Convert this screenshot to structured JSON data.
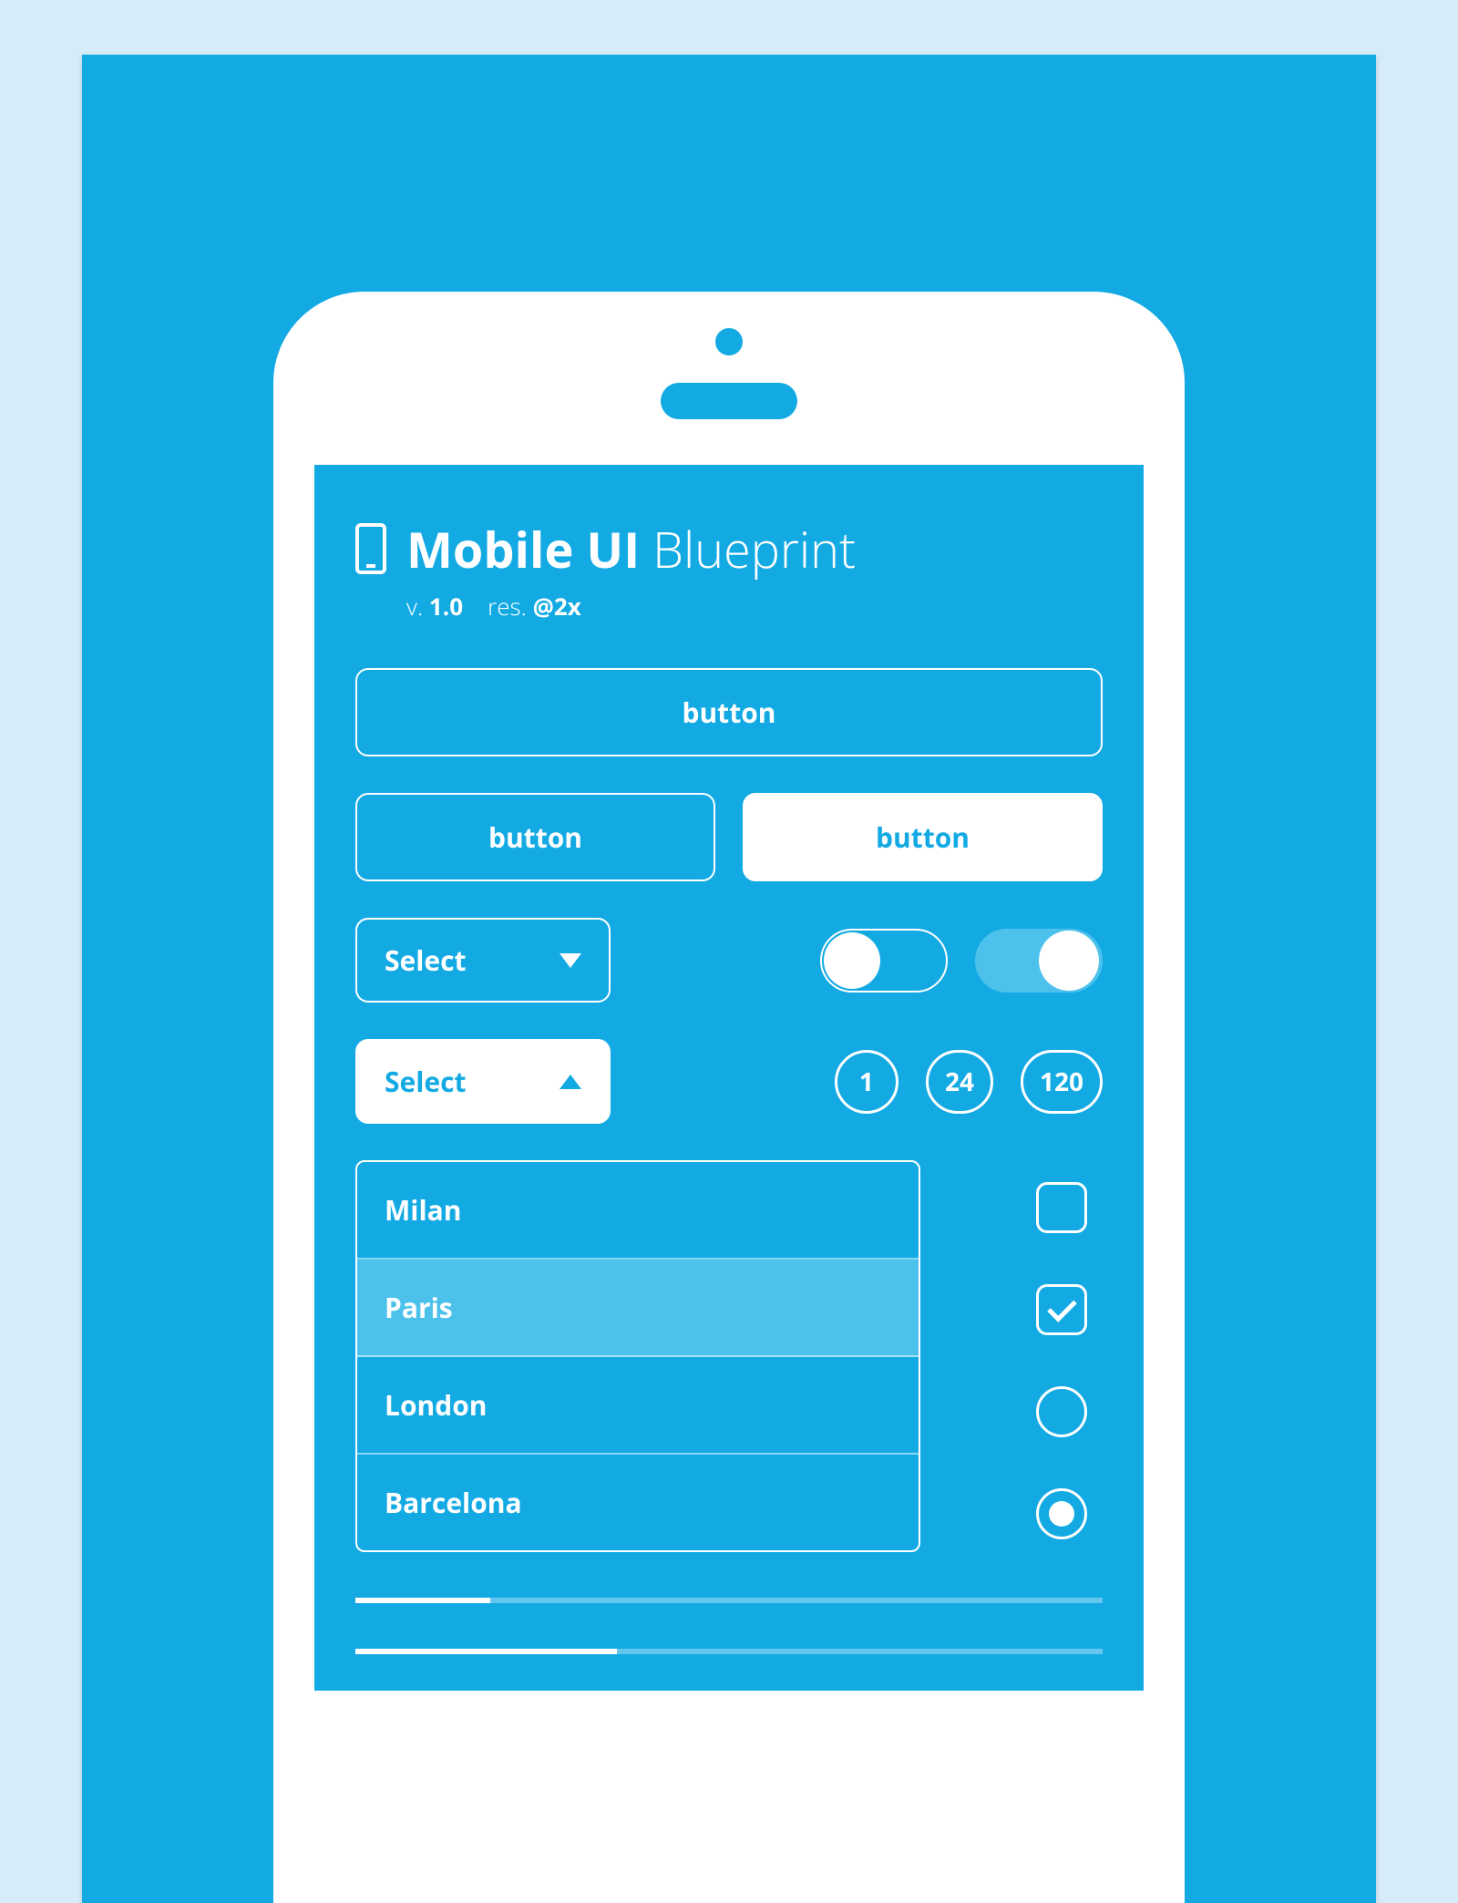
{
  "header": {
    "title_bold": "Mobile UI",
    "title_light": "Blueprint",
    "version_prefix": "v.",
    "version": "1.0",
    "res_prefix": "res.",
    "resolution": "@2x"
  },
  "buttons": {
    "full": "button",
    "half_left": "button",
    "half_right": "button"
  },
  "selects": {
    "closed_label": "Select",
    "open_label": "Select"
  },
  "badges": [
    "1",
    "24",
    "120"
  ],
  "list_items": [
    {
      "label": "Milan",
      "active": false
    },
    {
      "label": "Paris",
      "active": true
    },
    {
      "label": "London",
      "active": false
    },
    {
      "label": "Barcelona",
      "active": false
    }
  ],
  "checkboxes": [
    {
      "checked": false
    },
    {
      "checked": true
    }
  ],
  "radios": [
    {
      "selected": false
    },
    {
      "selected": true
    }
  ],
  "progress": [
    {
      "percent": 18
    },
    {
      "percent": 35
    }
  ]
}
